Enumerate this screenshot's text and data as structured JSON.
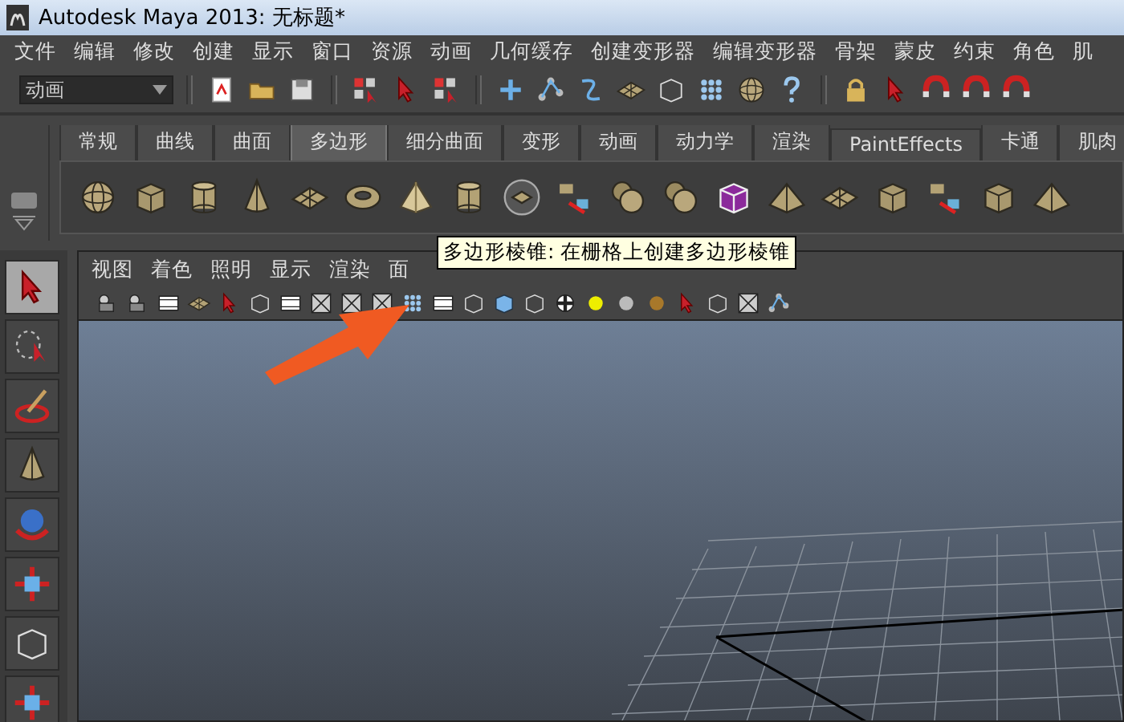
{
  "window": {
    "title": "Autodesk Maya 2013: 无标题*"
  },
  "menu_bar": [
    "文件",
    "编辑",
    "修改",
    "创建",
    "显示",
    "窗口",
    "资源",
    "动画",
    "几何缓存",
    "创建变形器",
    "编辑变形器",
    "骨架",
    "蒙皮",
    "约束",
    "角色",
    "肌"
  ],
  "status_line": {
    "menu_set": "动画"
  },
  "shelf": {
    "tabs": [
      {
        "label": "常规",
        "selected": false
      },
      {
        "label": "曲线",
        "selected": false
      },
      {
        "label": "曲面",
        "selected": false
      },
      {
        "label": "多边形",
        "selected": true
      },
      {
        "label": "细分曲面",
        "selected": false
      },
      {
        "label": "变形",
        "selected": false
      },
      {
        "label": "动画",
        "selected": false
      },
      {
        "label": "动力学",
        "selected": false
      },
      {
        "label": "渲染",
        "selected": false
      },
      {
        "label": "PaintEffects",
        "selected": false
      },
      {
        "label": "卡通",
        "selected": false
      },
      {
        "label": "肌肉",
        "selected": false
      }
    ]
  },
  "toolbox": {
    "tools": [
      {
        "selected": true
      },
      {
        "selected": false
      },
      {
        "selected": false
      },
      {
        "selected": false
      },
      {
        "selected": false
      },
      {
        "selected": false
      },
      {
        "selected": false
      },
      {
        "selected": false
      }
    ]
  },
  "panel": {
    "menu": [
      "视图",
      "着色",
      "照明",
      "显示",
      "渲染",
      "面"
    ]
  },
  "tooltip": {
    "text": "多边形棱锥: 在栅格上创建多边形棱锥"
  }
}
